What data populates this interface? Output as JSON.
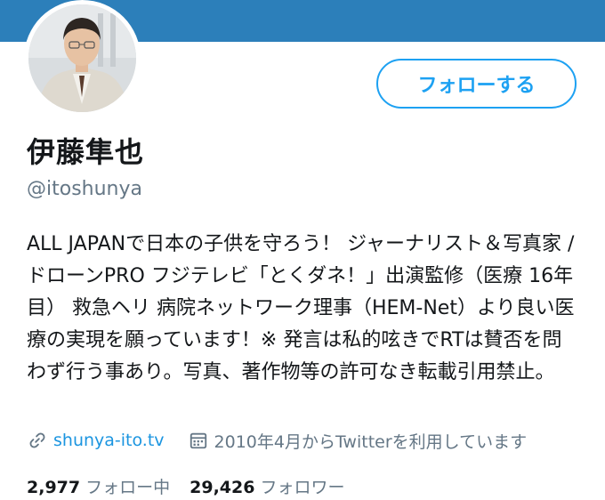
{
  "profile": {
    "display_name": "伊藤隼也",
    "handle": "@itoshunya",
    "bio": "ALL JAPANで日本の子供を守ろう！ ジャーナリスト＆写真家 /ドローンPRO フジテレビ「とくダネ！」出演監修（医療 16年目） 救急ヘリ 病院ネットワーク理事（HEM-Net）より良い医療の実現を願っています！※ 発言は私的呟きでRTは賛否を問わず行う事あり。写真、著作物等の許可なき転載引用禁止。",
    "website": "shunya-ito.tv",
    "joined": "2010年4月からTwitterを利用しています"
  },
  "actions": {
    "follow_label": "フォローする"
  },
  "stats": {
    "following_count": "2,977",
    "following_label": "フォロー中",
    "followers_count": "29,426",
    "followers_label": "フォロワー"
  },
  "colors": {
    "banner": "#2c7fba",
    "accent": "#1da1f2",
    "muted": "#657786"
  },
  "icons": {
    "website": "link-icon",
    "joined": "calendar-icon"
  }
}
